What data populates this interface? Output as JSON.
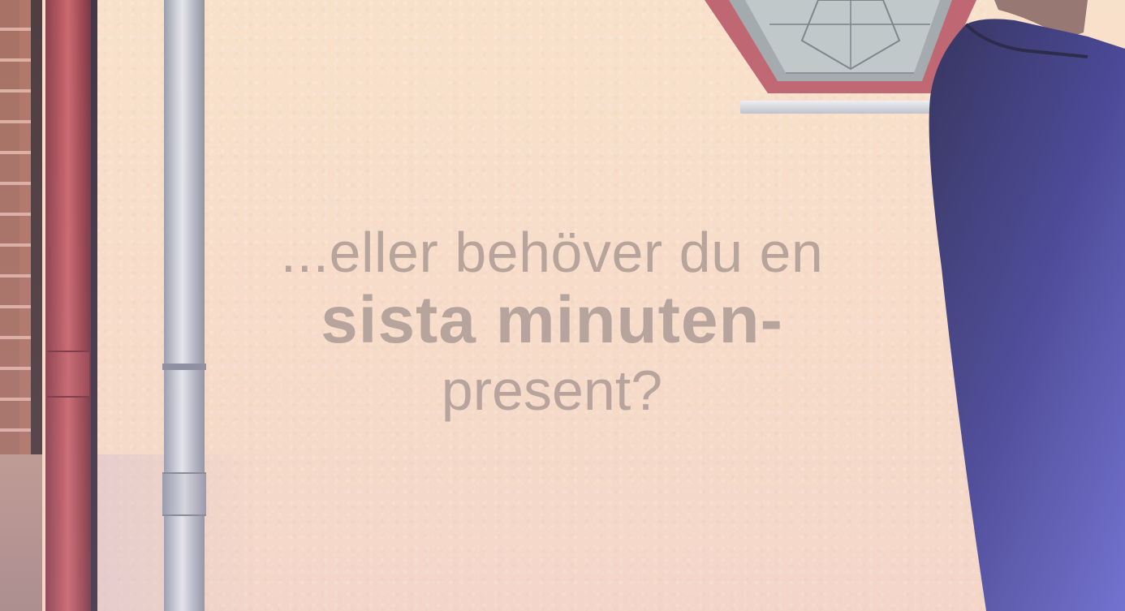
{
  "caption": {
    "line1": "...eller behöver du en",
    "line2": "sista minuten-",
    "line3": "present?"
  },
  "colors": {
    "caption_text": "#a8958b",
    "wall": "#f7dfc8",
    "red_pipe": "#b24a55",
    "grey_pipe": "#c9ccd6",
    "coat": "#2c2a6a",
    "window_frame": "#b85866"
  }
}
